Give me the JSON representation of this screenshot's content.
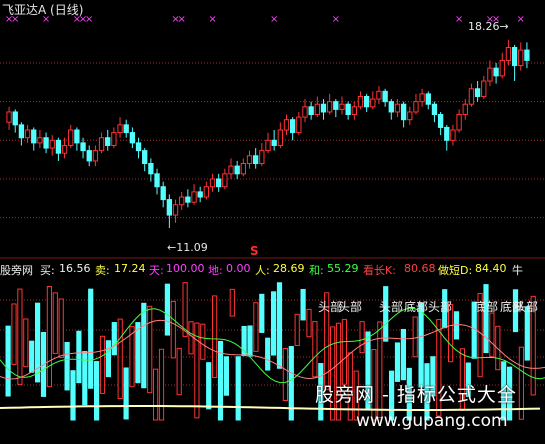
{
  "header": {
    "title": "飞亚达A (日线)"
  },
  "price_panel": {
    "high_label": "18.26",
    "low_label": "11.09",
    "signal_mark": "S",
    "ylim": [
      10.4,
      19.4
    ],
    "gridlines": [
      11.5,
      13.0,
      14.5,
      16.0,
      17.5
    ],
    "bars": [
      {
        "o": 15.2,
        "c": 15.6,
        "h": 15.8,
        "l": 14.9
      },
      {
        "o": 15.6,
        "c": 15.1,
        "h": 15.7,
        "l": 14.8
      },
      {
        "o": 15.1,
        "c": 14.6,
        "h": 15.2,
        "l": 14.3
      },
      {
        "o": 14.6,
        "c": 14.9,
        "h": 15.1,
        "l": 14.4
      },
      {
        "o": 14.9,
        "c": 14.4,
        "h": 15.0,
        "l": 14.1
      },
      {
        "o": 14.4,
        "c": 14.6,
        "h": 14.9,
        "l": 14.2
      },
      {
        "o": 14.6,
        "c": 14.2,
        "h": 14.8,
        "l": 14.0
      },
      {
        "o": 14.2,
        "c": 14.5,
        "h": 14.7,
        "l": 13.9
      },
      {
        "o": 14.5,
        "c": 14.0,
        "h": 14.6,
        "l": 13.7
      },
      {
        "o": 14.0,
        "c": 14.3,
        "h": 14.6,
        "l": 13.8
      },
      {
        "o": 14.3,
        "c": 14.9,
        "h": 15.1,
        "l": 14.2
      },
      {
        "o": 14.9,
        "c": 14.4,
        "h": 15.0,
        "l": 14.1
      },
      {
        "o": 14.4,
        "c": 14.1,
        "h": 14.6,
        "l": 13.8
      },
      {
        "o": 14.1,
        "c": 13.7,
        "h": 14.3,
        "l": 13.5
      },
      {
        "o": 13.7,
        "c": 14.1,
        "h": 14.3,
        "l": 13.5
      },
      {
        "o": 14.1,
        "c": 14.6,
        "h": 14.8,
        "l": 14.0
      },
      {
        "o": 14.6,
        "c": 14.3,
        "h": 14.9,
        "l": 14.1
      },
      {
        "o": 14.3,
        "c": 14.8,
        "h": 15.0,
        "l": 14.2
      },
      {
        "o": 14.8,
        "c": 15.1,
        "h": 15.4,
        "l": 14.6
      },
      {
        "o": 15.1,
        "c": 14.8,
        "h": 15.3,
        "l": 14.6
      },
      {
        "o": 14.8,
        "c": 14.4,
        "h": 15.0,
        "l": 14.2
      },
      {
        "o": 14.4,
        "c": 14.1,
        "h": 14.6,
        "l": 13.8
      },
      {
        "o": 14.1,
        "c": 13.6,
        "h": 14.2,
        "l": 13.3
      },
      {
        "o": 13.6,
        "c": 13.2,
        "h": 13.8,
        "l": 12.9
      },
      {
        "o": 13.2,
        "c": 12.7,
        "h": 13.4,
        "l": 12.4
      },
      {
        "o": 12.7,
        "c": 12.2,
        "h": 12.9,
        "l": 11.9
      },
      {
        "o": 12.2,
        "c": 11.6,
        "h": 12.4,
        "l": 11.1
      },
      {
        "o": 11.6,
        "c": 12.0,
        "h": 12.2,
        "l": 11.3
      },
      {
        "o": 12.0,
        "c": 12.3,
        "h": 12.5,
        "l": 11.8
      },
      {
        "o": 12.3,
        "c": 12.1,
        "h": 12.6,
        "l": 11.9
      },
      {
        "o": 12.1,
        "c": 12.5,
        "h": 12.8,
        "l": 12.0
      },
      {
        "o": 12.5,
        "c": 12.3,
        "h": 12.7,
        "l": 12.1
      },
      {
        "o": 12.3,
        "c": 12.7,
        "h": 12.9,
        "l": 12.2
      },
      {
        "o": 12.7,
        "c": 13.0,
        "h": 13.2,
        "l": 12.5
      },
      {
        "o": 13.0,
        "c": 12.7,
        "h": 13.2,
        "l": 12.5
      },
      {
        "o": 12.7,
        "c": 13.2,
        "h": 13.4,
        "l": 12.6
      },
      {
        "o": 13.2,
        "c": 13.5,
        "h": 13.8,
        "l": 13.0
      },
      {
        "o": 13.5,
        "c": 13.2,
        "h": 13.7,
        "l": 13.0
      },
      {
        "o": 13.2,
        "c": 13.6,
        "h": 13.8,
        "l": 13.1
      },
      {
        "o": 13.6,
        "c": 13.9,
        "h": 14.1,
        "l": 13.4
      },
      {
        "o": 13.9,
        "c": 13.6,
        "h": 14.2,
        "l": 13.4
      },
      {
        "o": 13.6,
        "c": 14.1,
        "h": 14.4,
        "l": 13.5
      },
      {
        "o": 14.1,
        "c": 14.5,
        "h": 14.8,
        "l": 14.0
      },
      {
        "o": 14.5,
        "c": 14.3,
        "h": 14.9,
        "l": 14.1
      },
      {
        "o": 14.3,
        "c": 14.9,
        "h": 15.2,
        "l": 14.2
      },
      {
        "o": 14.9,
        "c": 15.3,
        "h": 15.5,
        "l": 14.7
      },
      {
        "o": 15.3,
        "c": 14.8,
        "h": 15.4,
        "l": 14.5
      },
      {
        "o": 14.8,
        "c": 15.4,
        "h": 15.6,
        "l": 14.7
      },
      {
        "o": 15.4,
        "c": 15.8,
        "h": 16.1,
        "l": 15.2
      },
      {
        "o": 15.8,
        "c": 15.5,
        "h": 16.0,
        "l": 15.3
      },
      {
        "o": 15.5,
        "c": 15.9,
        "h": 16.2,
        "l": 15.4
      },
      {
        "o": 15.9,
        "c": 15.6,
        "h": 16.1,
        "l": 15.3
      },
      {
        "o": 15.6,
        "c": 16.0,
        "h": 16.3,
        "l": 15.5
      },
      {
        "o": 16.0,
        "c": 15.7,
        "h": 16.1,
        "l": 15.4
      },
      {
        "o": 15.7,
        "c": 15.9,
        "h": 16.2,
        "l": 15.5
      },
      {
        "o": 15.9,
        "c": 15.5,
        "h": 16.0,
        "l": 15.3
      },
      {
        "o": 15.5,
        "c": 15.8,
        "h": 16.0,
        "l": 15.3
      },
      {
        "o": 15.8,
        "c": 16.2,
        "h": 16.4,
        "l": 15.7
      },
      {
        "o": 16.2,
        "c": 15.8,
        "h": 16.3,
        "l": 15.6
      },
      {
        "o": 15.8,
        "c": 16.1,
        "h": 16.4,
        "l": 15.7
      },
      {
        "o": 16.1,
        "c": 16.4,
        "h": 16.6,
        "l": 15.9
      },
      {
        "o": 16.4,
        "c": 16.0,
        "h": 16.5,
        "l": 15.8
      },
      {
        "o": 16.0,
        "c": 15.6,
        "h": 16.1,
        "l": 15.3
      },
      {
        "o": 15.6,
        "c": 15.9,
        "h": 16.1,
        "l": 15.4
      },
      {
        "o": 15.9,
        "c": 15.3,
        "h": 16.0,
        "l": 15.0
      },
      {
        "o": 15.3,
        "c": 15.6,
        "h": 15.8,
        "l": 15.1
      },
      {
        "o": 15.6,
        "c": 16.0,
        "h": 16.3,
        "l": 15.5
      },
      {
        "o": 16.0,
        "c": 16.3,
        "h": 16.5,
        "l": 15.8
      },
      {
        "o": 16.3,
        "c": 15.9,
        "h": 16.4,
        "l": 15.7
      },
      {
        "o": 15.9,
        "c": 15.5,
        "h": 16.0,
        "l": 15.2
      },
      {
        "o": 15.5,
        "c": 15.0,
        "h": 15.6,
        "l": 14.7
      },
      {
        "o": 15.0,
        "c": 14.5,
        "h": 15.1,
        "l": 14.1
      },
      {
        "o": 14.5,
        "c": 14.9,
        "h": 15.1,
        "l": 14.3
      },
      {
        "o": 14.9,
        "c": 15.5,
        "h": 15.7,
        "l": 14.8
      },
      {
        "o": 15.5,
        "c": 15.9,
        "h": 16.1,
        "l": 15.3
      },
      {
        "o": 15.9,
        "c": 16.5,
        "h": 16.7,
        "l": 15.8
      },
      {
        "o": 16.5,
        "c": 16.2,
        "h": 16.8,
        "l": 16.0
      },
      {
        "o": 16.2,
        "c": 16.8,
        "h": 17.0,
        "l": 16.1
      },
      {
        "o": 16.8,
        "c": 17.3,
        "h": 17.6,
        "l": 16.6
      },
      {
        "o": 17.3,
        "c": 17.0,
        "h": 17.5,
        "l": 16.7
      },
      {
        "o": 17.0,
        "c": 17.6,
        "h": 17.9,
        "l": 16.9
      },
      {
        "o": 17.6,
        "c": 18.1,
        "h": 18.4,
        "l": 17.4
      },
      {
        "o": 18.1,
        "c": 17.4,
        "h": 18.2,
        "l": 16.8
      },
      {
        "o": 17.4,
        "c": 18.0,
        "h": 18.3,
        "l": 17.2
      },
      {
        "o": 18.0,
        "c": 17.6,
        "h": 18.3,
        "l": 17.3
      }
    ],
    "top_marks": [
      {
        "i": 0,
        "sym": "×"
      },
      {
        "i": 1,
        "sym": "×"
      },
      {
        "i": 6,
        "sym": "×"
      },
      {
        "i": 11,
        "sym": "×"
      },
      {
        "i": 12,
        "sym": "×"
      },
      {
        "i": 13,
        "sym": "×"
      },
      {
        "i": 27,
        "sym": "×"
      },
      {
        "i": 28,
        "sym": "×"
      },
      {
        "i": 33,
        "sym": "×"
      },
      {
        "i": 43,
        "sym": "×"
      },
      {
        "i": 53,
        "sym": "×"
      },
      {
        "i": 73,
        "sym": "×"
      },
      {
        "i": 78,
        "sym": "×"
      },
      {
        "i": 79,
        "sym": "×"
      },
      {
        "i": 83,
        "sym": "×"
      }
    ]
  },
  "indicator_bar": {
    "name": "股旁网",
    "items": [
      {
        "label": "买:",
        "value": "16.56",
        "color": "#f0f0f0"
      },
      {
        "label": "卖:",
        "value": "17.24",
        "color": "#ffff40"
      },
      {
        "label": "天:",
        "value": "100.00",
        "color": "#ff40ff"
      },
      {
        "label": "地:",
        "value": "0.00",
        "color": "#ff40ff"
      },
      {
        "label": "人:",
        "value": "28.69",
        "color": "#ffff40"
      },
      {
        "label": "和:",
        "value": "55.29",
        "color": "#40ff40"
      },
      {
        "label": "看长K:",
        "value": "80.68",
        "color": "#ff4040"
      },
      {
        "label": "做短D:",
        "value": "84.40",
        "color": "#ffff40"
      },
      {
        "label": "牛",
        "value": "",
        "color": "#f0f0f0"
      }
    ]
  },
  "lower_panel": {
    "labels": [
      "头部",
      "头部",
      "底部",
      "头部",
      "底部",
      "头部",
      "底部",
      "头部"
    ],
    "gridlines": [
      300,
      330,
      357,
      385
    ]
  },
  "watermark": {
    "text": "股旁网 - 指标公式大全",
    "url": "www.gupang.com"
  },
  "colors": {
    "up": "#ff3333",
    "down": "#54ffff",
    "grid": "#a52a2a",
    "pink": "#ff40ff",
    "yellow_line": "#ffffc0",
    "green_line": "#40ff40"
  }
}
